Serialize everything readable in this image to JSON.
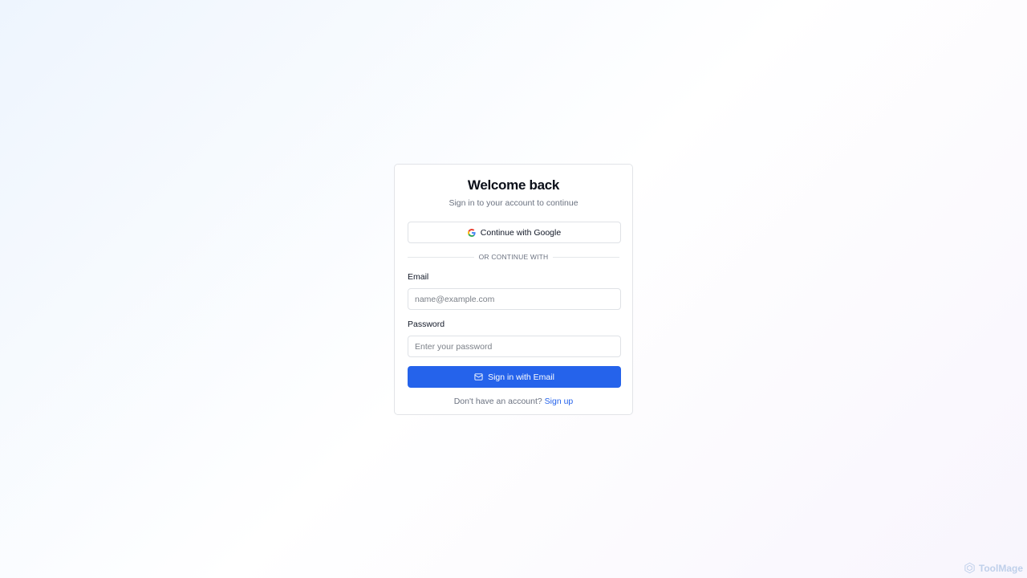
{
  "login": {
    "title": "Welcome back",
    "subtitle": "Sign in to your account to continue",
    "google_button": "Continue with Google",
    "divider": "OR CONTINUE WITH",
    "email_label": "Email",
    "email_placeholder": "name@example.com",
    "email_value": "",
    "password_label": "Password",
    "password_placeholder": "Enter your password",
    "password_value": "",
    "submit_button": "Sign in with Email",
    "footer_prompt": "Don't have an account?",
    "signup_link": "Sign up"
  },
  "watermark": {
    "text": "ToolMage"
  },
  "icons": {
    "google": "google-icon",
    "mail": "mail-icon",
    "watermark": "toolmage-logo-icon"
  },
  "colors": {
    "primary": "#2563eb",
    "border": "#dfe2e6",
    "muted_text": "#6b7280"
  }
}
